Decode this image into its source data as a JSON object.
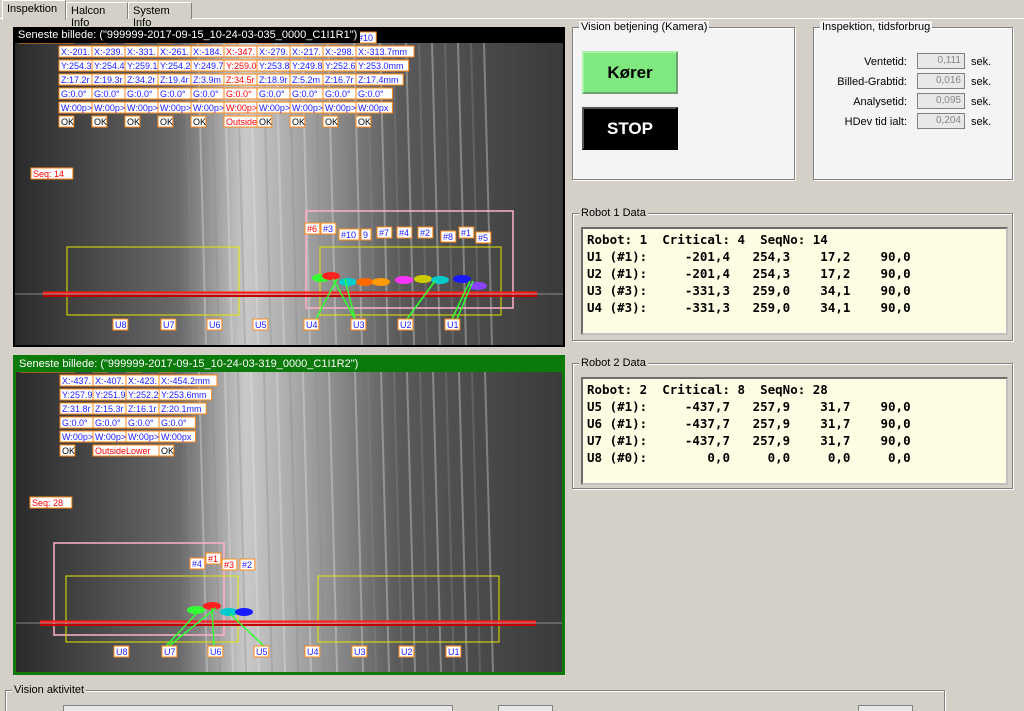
{
  "tabs": [
    "Inspektion",
    "Halcon Info",
    "System Info"
  ],
  "cam1": {
    "title": "Seneste billede: (\"999999-2017-09-15_10-24-03-035_0000_C1I1R1\")",
    "seq": "Seq: 14",
    "polser_label": "Pølser: 1",
    "ids": [
      "#1",
      "#2",
      "#3",
      "#4",
      "#5",
      "#6",
      "#7",
      "#8",
      "#9",
      "#10"
    ],
    "x_vals": [
      "X:-201.",
      "X:-239.",
      "X:-331.",
      "X:-261.",
      "X:-184.",
      "X:-347.",
      "X:-279.",
      "X:-217.",
      "X:-298.",
      "X:-313.7mm"
    ],
    "y_vals": [
      "Y:254.3",
      "Y:254.4",
      "Y:259.1",
      "Y:254.2",
      "Y:249.7",
      "Y:259.0",
      "Y:253.8",
      "Y:249.8",
      "Y:252.6",
      "Y:253.0mm"
    ],
    "z_vals": [
      "Z:17.2r",
      "Z:19.3r",
      "Z:34.2r",
      "Z:19.4r",
      "Z:3.9m",
      "Z:34.5r",
      "Z:18.9r",
      "Z:5.2m",
      "Z:16.7r",
      "Z:17.4mm"
    ],
    "g_vals": [
      "G:0.0°",
      "G:0.0°",
      "G:0.0°",
      "G:0.0°",
      "G:0.0°",
      "G:0.0°",
      "G:0.0°",
      "G:0.0°",
      "G:0.0°",
      "G:0.0°"
    ],
    "w_vals": [
      "W:00p>",
      "W:00p>",
      "W:00p>",
      "W:00p>",
      "W:00p>",
      "W:00p>",
      "W:00p>",
      "W:00p>",
      "W:00p>",
      "W:00px"
    ],
    "status": [
      "OK",
      "OK",
      "OK",
      "OK",
      "OK",
      "Outside",
      "OK",
      "OK",
      "OK",
      "OK"
    ],
    "zone_labels": [
      "U8",
      "U7",
      "U6",
      "U5",
      "U4",
      "U3",
      "U2",
      "U1"
    ],
    "overlay_ids": [
      "#6",
      "#3",
      "#10",
      "9",
      "#7",
      "#4",
      "#2",
      "#8",
      "#1",
      "#5"
    ]
  },
  "cam2": {
    "title": "Seneste billede: (\"999999-2017-09-15_10-24-03-319_0000_C1I1R2\")",
    "seq": "Seq: 28",
    "polser_label": "Pølser: 4",
    "ids": [
      "#1",
      "#2",
      "#3",
      "#4"
    ],
    "x_vals": [
      "X:-437.",
      "X:-407.",
      "X:-423.",
      "X:-454.2mm"
    ],
    "y_vals": [
      "Y:257.9",
      "Y:251.9",
      "Y:252.2",
      "Y:253.6mm"
    ],
    "z_vals": [
      "Z:31.8r",
      "Z:15.3r",
      "Z:16.1r",
      "Z:20.1mm"
    ],
    "g_vals": [
      "G:0.0°",
      "G:0.0°",
      "G:0.0°",
      "G:0.0°"
    ],
    "w_vals": [
      "W:00p>",
      "W:00p>",
      "W:00p>",
      "W:00px"
    ],
    "status": [
      "OK",
      "OutsideLower",
      "OK"
    ],
    "zone_labels": [
      "U8",
      "U7",
      "U6",
      "U5",
      "U4",
      "U3",
      "U2",
      "U1"
    ],
    "overlay_ids": [
      "#4",
      "#1",
      "#3",
      "#2"
    ]
  },
  "vision": {
    "legend": "Vision betjening (Kamera)",
    "run_label": "Kører",
    "stop_label": "STOP"
  },
  "inspection_time": {
    "legend": "Inspektion, tidsforbrug",
    "rows": [
      {
        "label": "Ventetid:",
        "value": "0,111",
        "unit": "sek."
      },
      {
        "label": "Billed-Grabtid:",
        "value": "0,016",
        "unit": "sek."
      },
      {
        "label": "Analysetid:",
        "value": "0,095",
        "unit": "sek."
      },
      {
        "label": "HDev tid ialt:",
        "value": "0,204",
        "unit": "sek."
      }
    ]
  },
  "robot1": {
    "legend": "Robot 1 Data",
    "lines": [
      "Robot: 1  Critical: 4  SeqNo: 14",
      "U1 (#1):     -201,4   254,3    17,2    90,0",
      "U2 (#1):     -201,4   254,3    17,2    90,0",
      "U3 (#3):     -331,3   259,0    34,1    90,0",
      "U4 (#3):     -331,3   259,0    34,1    90,0"
    ]
  },
  "robot2": {
    "legend": "Robot 2 Data",
    "lines": [
      "Robot: 2  Critical: 8  SeqNo: 28",
      "U5 (#1):     -437,7   257,9    31,7    90,0",
      "U6 (#1):     -437,7   257,9    31,7    90,0",
      "U7 (#1):     -437,7   257,9    31,7    90,0",
      "U8 (#0):        0,0     0,0     0,0     0,0"
    ]
  },
  "activity": {
    "legend": "Vision aktivitet"
  },
  "colors": {
    "run_green": "#7fe87f",
    "cam2_border": "#0a7a0a",
    "overlay_orange": "#ff6a00",
    "overlay_blue": "#1a1aff",
    "overlay_red": "#ff0000"
  }
}
